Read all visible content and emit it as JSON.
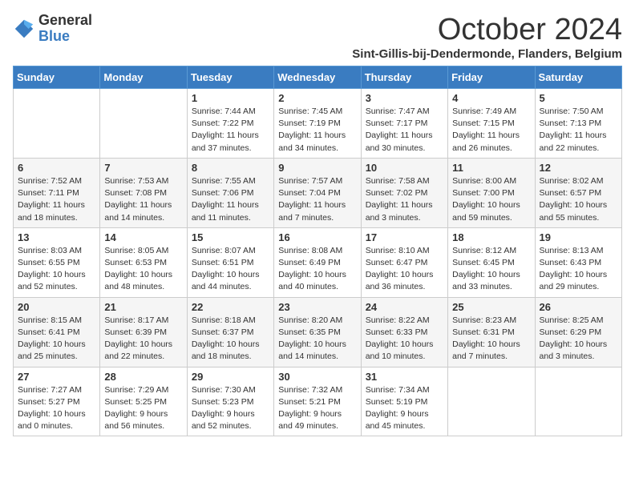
{
  "logo": {
    "general": "General",
    "blue": "Blue"
  },
  "title": "October 2024",
  "subtitle": "Sint-Gillis-bij-Dendermonde, Flanders, Belgium",
  "days_of_week": [
    "Sunday",
    "Monday",
    "Tuesday",
    "Wednesday",
    "Thursday",
    "Friday",
    "Saturday"
  ],
  "weeks": [
    [
      {
        "day": "",
        "info": ""
      },
      {
        "day": "",
        "info": ""
      },
      {
        "day": "1",
        "info": "Sunrise: 7:44 AM\nSunset: 7:22 PM\nDaylight: 11 hours and 37 minutes."
      },
      {
        "day": "2",
        "info": "Sunrise: 7:45 AM\nSunset: 7:19 PM\nDaylight: 11 hours and 34 minutes."
      },
      {
        "day": "3",
        "info": "Sunrise: 7:47 AM\nSunset: 7:17 PM\nDaylight: 11 hours and 30 minutes."
      },
      {
        "day": "4",
        "info": "Sunrise: 7:49 AM\nSunset: 7:15 PM\nDaylight: 11 hours and 26 minutes."
      },
      {
        "day": "5",
        "info": "Sunrise: 7:50 AM\nSunset: 7:13 PM\nDaylight: 11 hours and 22 minutes."
      }
    ],
    [
      {
        "day": "6",
        "info": "Sunrise: 7:52 AM\nSunset: 7:11 PM\nDaylight: 11 hours and 18 minutes."
      },
      {
        "day": "7",
        "info": "Sunrise: 7:53 AM\nSunset: 7:08 PM\nDaylight: 11 hours and 14 minutes."
      },
      {
        "day": "8",
        "info": "Sunrise: 7:55 AM\nSunset: 7:06 PM\nDaylight: 11 hours and 11 minutes."
      },
      {
        "day": "9",
        "info": "Sunrise: 7:57 AM\nSunset: 7:04 PM\nDaylight: 11 hours and 7 minutes."
      },
      {
        "day": "10",
        "info": "Sunrise: 7:58 AM\nSunset: 7:02 PM\nDaylight: 11 hours and 3 minutes."
      },
      {
        "day": "11",
        "info": "Sunrise: 8:00 AM\nSunset: 7:00 PM\nDaylight: 10 hours and 59 minutes."
      },
      {
        "day": "12",
        "info": "Sunrise: 8:02 AM\nSunset: 6:57 PM\nDaylight: 10 hours and 55 minutes."
      }
    ],
    [
      {
        "day": "13",
        "info": "Sunrise: 8:03 AM\nSunset: 6:55 PM\nDaylight: 10 hours and 52 minutes."
      },
      {
        "day": "14",
        "info": "Sunrise: 8:05 AM\nSunset: 6:53 PM\nDaylight: 10 hours and 48 minutes."
      },
      {
        "day": "15",
        "info": "Sunrise: 8:07 AM\nSunset: 6:51 PM\nDaylight: 10 hours and 44 minutes."
      },
      {
        "day": "16",
        "info": "Sunrise: 8:08 AM\nSunset: 6:49 PM\nDaylight: 10 hours and 40 minutes."
      },
      {
        "day": "17",
        "info": "Sunrise: 8:10 AM\nSunset: 6:47 PM\nDaylight: 10 hours and 36 minutes."
      },
      {
        "day": "18",
        "info": "Sunrise: 8:12 AM\nSunset: 6:45 PM\nDaylight: 10 hours and 33 minutes."
      },
      {
        "day": "19",
        "info": "Sunrise: 8:13 AM\nSunset: 6:43 PM\nDaylight: 10 hours and 29 minutes."
      }
    ],
    [
      {
        "day": "20",
        "info": "Sunrise: 8:15 AM\nSunset: 6:41 PM\nDaylight: 10 hours and 25 minutes."
      },
      {
        "day": "21",
        "info": "Sunrise: 8:17 AM\nSunset: 6:39 PM\nDaylight: 10 hours and 22 minutes."
      },
      {
        "day": "22",
        "info": "Sunrise: 8:18 AM\nSunset: 6:37 PM\nDaylight: 10 hours and 18 minutes."
      },
      {
        "day": "23",
        "info": "Sunrise: 8:20 AM\nSunset: 6:35 PM\nDaylight: 10 hours and 14 minutes."
      },
      {
        "day": "24",
        "info": "Sunrise: 8:22 AM\nSunset: 6:33 PM\nDaylight: 10 hours and 10 minutes."
      },
      {
        "day": "25",
        "info": "Sunrise: 8:23 AM\nSunset: 6:31 PM\nDaylight: 10 hours and 7 minutes."
      },
      {
        "day": "26",
        "info": "Sunrise: 8:25 AM\nSunset: 6:29 PM\nDaylight: 10 hours and 3 minutes."
      }
    ],
    [
      {
        "day": "27",
        "info": "Sunrise: 7:27 AM\nSunset: 5:27 PM\nDaylight: 10 hours and 0 minutes."
      },
      {
        "day": "28",
        "info": "Sunrise: 7:29 AM\nSunset: 5:25 PM\nDaylight: 9 hours and 56 minutes."
      },
      {
        "day": "29",
        "info": "Sunrise: 7:30 AM\nSunset: 5:23 PM\nDaylight: 9 hours and 52 minutes."
      },
      {
        "day": "30",
        "info": "Sunrise: 7:32 AM\nSunset: 5:21 PM\nDaylight: 9 hours and 49 minutes."
      },
      {
        "day": "31",
        "info": "Sunrise: 7:34 AM\nSunset: 5:19 PM\nDaylight: 9 hours and 45 minutes."
      },
      {
        "day": "",
        "info": ""
      },
      {
        "day": "",
        "info": ""
      }
    ]
  ]
}
